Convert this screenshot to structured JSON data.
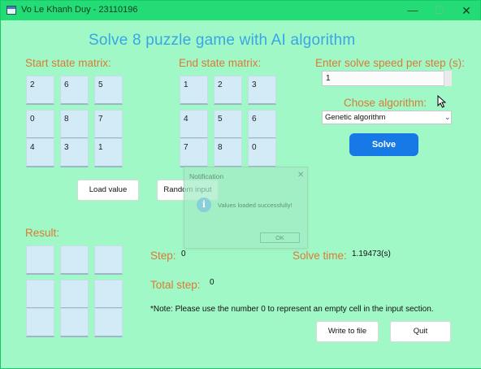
{
  "window": {
    "title": "Vo Le Khanh Duy - 23110196",
    "minimize_glyph": "—",
    "maximize_glyph": "☐",
    "close_glyph": "✕"
  },
  "app": {
    "heading": "Solve 8 puzzle game with AI algorithm"
  },
  "start": {
    "label": "Start state matrix:",
    "cells": [
      "2",
      "6",
      "5",
      "0",
      "8",
      "7",
      "4",
      "3",
      "1"
    ]
  },
  "end": {
    "label": "End state matrix:",
    "cells": [
      "1",
      "2",
      "3",
      "4",
      "5",
      "6",
      "7",
      "8",
      "0"
    ]
  },
  "speed": {
    "label": "Enter solve speed per step (s):",
    "value": "1"
  },
  "algorithm": {
    "label": "Chose algorithm:",
    "selected": "Genetic algorithm"
  },
  "buttons": {
    "solve": "Solve",
    "load": "Load value",
    "random": "Random input",
    "write": "Write to file",
    "quit": "Quit"
  },
  "result": {
    "label": "Result:",
    "cells": [
      "",
      "",
      "",
      "",
      "",
      "",
      "",
      "",
      ""
    ]
  },
  "stats": {
    "step_label": "Step:",
    "step_value": "0",
    "total_label": "Total step:",
    "total_value": "0",
    "time_label": "Solve time:",
    "time_value": "1.19473(s)"
  },
  "note": "*Note: Please use the number 0 to represent an empty cell in the input section.",
  "dialog": {
    "title": "Notification",
    "icon": "info-icon",
    "message": "Values loaded successfully!",
    "ok": "OK",
    "close_glyph": "✕"
  },
  "colors": {
    "background": "#a1f8c7",
    "titlebar": "#24dc76",
    "heading": "#38a6e6",
    "label": "#d97b35",
    "cell": "#d3eaf7",
    "solve_button": "#1679e6"
  }
}
